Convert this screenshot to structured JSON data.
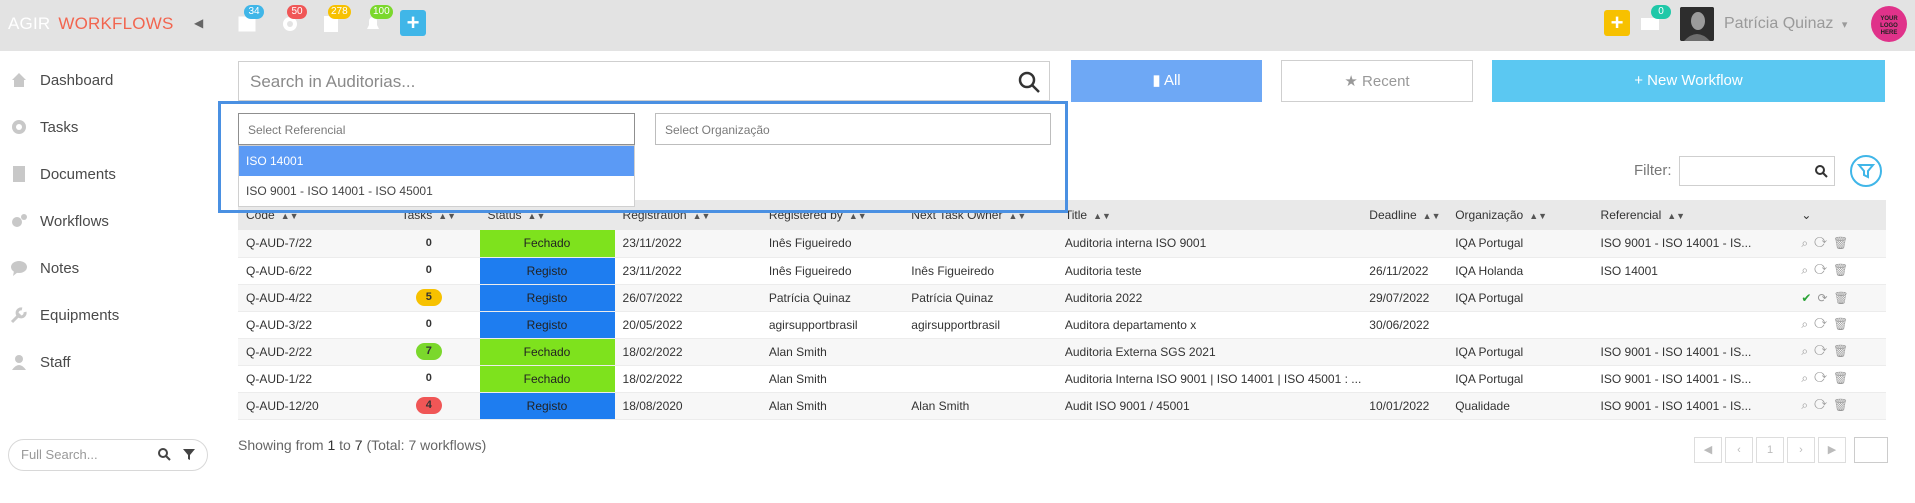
{
  "header": {
    "brand_a": "AGIR",
    "brand_w": "WORKFLOWS",
    "badges": {
      "calendar": "34",
      "settings": "50",
      "files": "278",
      "alerts": "100",
      "messages": "0"
    },
    "username": "Patrícia Quinaz",
    "logo_text": "YOUR LOGO HERE"
  },
  "sidebar": {
    "items": [
      {
        "label": "Dashboard",
        "icon": "home-icon"
      },
      {
        "label": "Tasks",
        "icon": "gear-icon"
      },
      {
        "label": "Documents",
        "icon": "document-icon"
      },
      {
        "label": "Workflows",
        "icon": "cogs-icon"
      },
      {
        "label": "Notes",
        "icon": "chat-icon"
      },
      {
        "label": "Equipments",
        "icon": "wrench-icon"
      },
      {
        "label": "Staff",
        "icon": "user-icon"
      }
    ],
    "full_search_placeholder": "Full Search..."
  },
  "main": {
    "search_placeholder": "Search in Auditorias...",
    "btn_all": "All",
    "btn_recent": "Recent",
    "btn_new": "+ New Workflow",
    "select_referencial": "Select Referencial",
    "select_organizacao": "Select Organização",
    "dropdown_options": [
      "ISO 14001",
      "ISO 9001 - ISO 14001 - ISO 45001"
    ],
    "filter_label": "Filter:",
    "columns": [
      "Code",
      "Tasks",
      "Status",
      "Registration",
      "Registered by",
      "Next Task Owner",
      "Title",
      "Deadline",
      "Organização",
      "Referencial"
    ],
    "rows": [
      {
        "code": "Q-AUD-7/22",
        "tasks": "0",
        "status": "Fechado",
        "registration": "23/11/2022",
        "registered_by": "Inês Figueiredo",
        "next_owner": "",
        "title": "Auditoria interna ISO 9001",
        "deadline": "",
        "org": "IQA Portugal",
        "ref": "ISO 9001 - ISO 14001 - IS..."
      },
      {
        "code": "Q-AUD-6/22",
        "tasks": "0",
        "status": "Registo",
        "registration": "23/11/2022",
        "registered_by": "Inês Figueiredo",
        "next_owner": "Inês Figueiredo",
        "title": "Auditoria teste",
        "deadline": "26/11/2022",
        "org": "IQA Holanda",
        "ref": "ISO 14001"
      },
      {
        "code": "Q-AUD-4/22",
        "tasks": "5",
        "status": "Registo",
        "registration": "26/07/2022",
        "registered_by": "Patrícia Quinaz",
        "next_owner": "Patrícia Quinaz",
        "title": "Auditoria 2022",
        "deadline": "29/07/2022",
        "org": "IQA Portugal",
        "ref": ""
      },
      {
        "code": "Q-AUD-3/22",
        "tasks": "0",
        "status": "Registo",
        "registration": "20/05/2022",
        "registered_by": "agirsupportbrasil",
        "next_owner": "agirsupportbrasil",
        "title": "Auditora departamento x",
        "deadline": "30/06/2022",
        "org": "",
        "ref": ""
      },
      {
        "code": "Q-AUD-2/22",
        "tasks": "7",
        "status": "Fechado",
        "registration": "18/02/2022",
        "registered_by": "Alan Smith",
        "next_owner": "",
        "title": "Auditoria Externa SGS 2021",
        "deadline": "",
        "org": "IQA Portugal",
        "ref": "ISO 9001 - ISO 14001 - IS..."
      },
      {
        "code": "Q-AUD-1/22",
        "tasks": "0",
        "status": "Fechado",
        "registration": "18/02/2022",
        "registered_by": "Alan Smith",
        "next_owner": "",
        "title": "Auditoria Interna ISO 9001 | ISO 14001 | ISO 45001 : ...",
        "deadline": "",
        "org": "IQA Portugal",
        "ref": "ISO 9001 - ISO 14001 - IS..."
      },
      {
        "code": "Q-AUD-12/20",
        "tasks": "4",
        "status": "Registo",
        "registration": "18/08/2020",
        "registered_by": "Alan Smith",
        "next_owner": "Alan Smith",
        "title": "Audit ISO 9001 / 45001",
        "deadline": "10/01/2022",
        "org": "Qualidade",
        "ref": "ISO 9001 - ISO 14001 - IS..."
      }
    ],
    "showing": {
      "prefix": "Showing from",
      "from": "1",
      "to_word": "to",
      "to": "7",
      "total": "(Total: 7 workflows)"
    },
    "pager_page": "1"
  },
  "colors": {
    "fechado": "#7ee21d",
    "registo": "#1e7df0",
    "accent": "#40b6e8",
    "btn_all": "#6ea8f5",
    "btn_new": "#5bc8f2",
    "pill_yellow": "#f7c100",
    "pill_green": "#7bd82c",
    "pill_red": "#f05656"
  }
}
